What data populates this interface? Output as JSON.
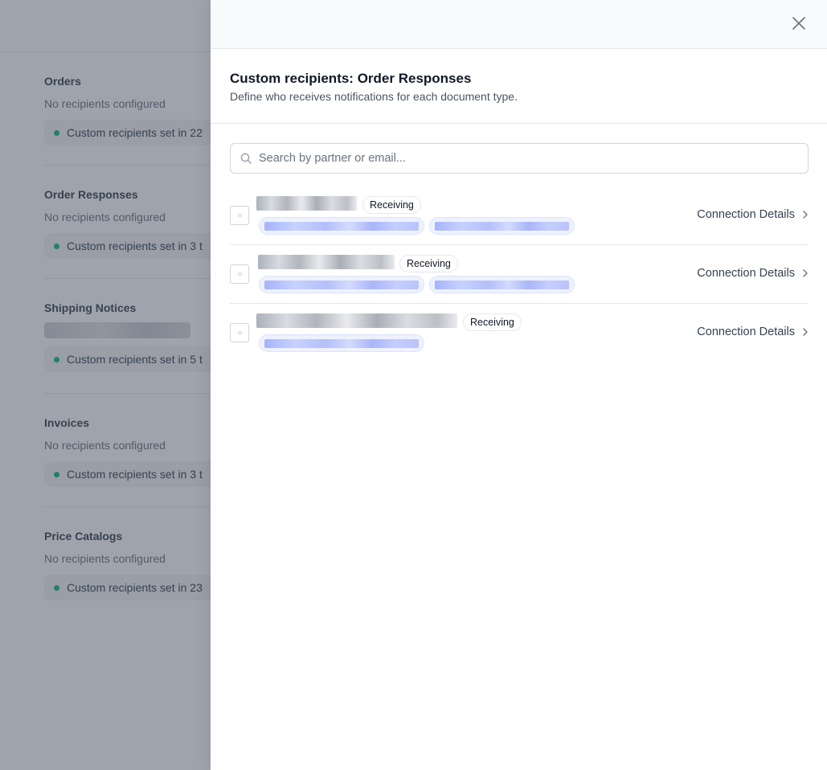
{
  "background": {
    "sections": [
      {
        "title": "Orders",
        "subtitle": "No recipients configured",
        "status": "Custom recipients set in 22"
      },
      {
        "title": "Order Responses",
        "subtitle": "No recipients configured",
        "status": "Custom recipients set in 3 t"
      },
      {
        "title": "Shipping Notices",
        "subtitle": "",
        "status": "Custom recipients set in 5 t"
      },
      {
        "title": "Invoices",
        "subtitle": "No recipients configured",
        "status": "Custom recipients set in 3 t"
      },
      {
        "title": "Price Catalogs",
        "subtitle": "No recipients configured",
        "status": "Custom recipients set in 23"
      }
    ]
  },
  "drawer": {
    "title": "Custom recipients: Order Responses",
    "subtitle": "Define who receives notifications for each document type.",
    "search": {
      "placeholder": "Search by partner or email..."
    },
    "rows": [
      {
        "badge": "Receiving",
        "link": "Connection Details"
      },
      {
        "badge": "Receiving",
        "link": "Connection Details"
      },
      {
        "badge": "Receiving",
        "link": "Connection Details"
      }
    ]
  },
  "icons": {
    "close": "close-icon",
    "search": "search-icon",
    "chevron": "chevron-right-icon"
  },
  "colors": {
    "status_dot": "#10b981",
    "email_chip": "#eef2ff",
    "overlay": "#374151"
  }
}
